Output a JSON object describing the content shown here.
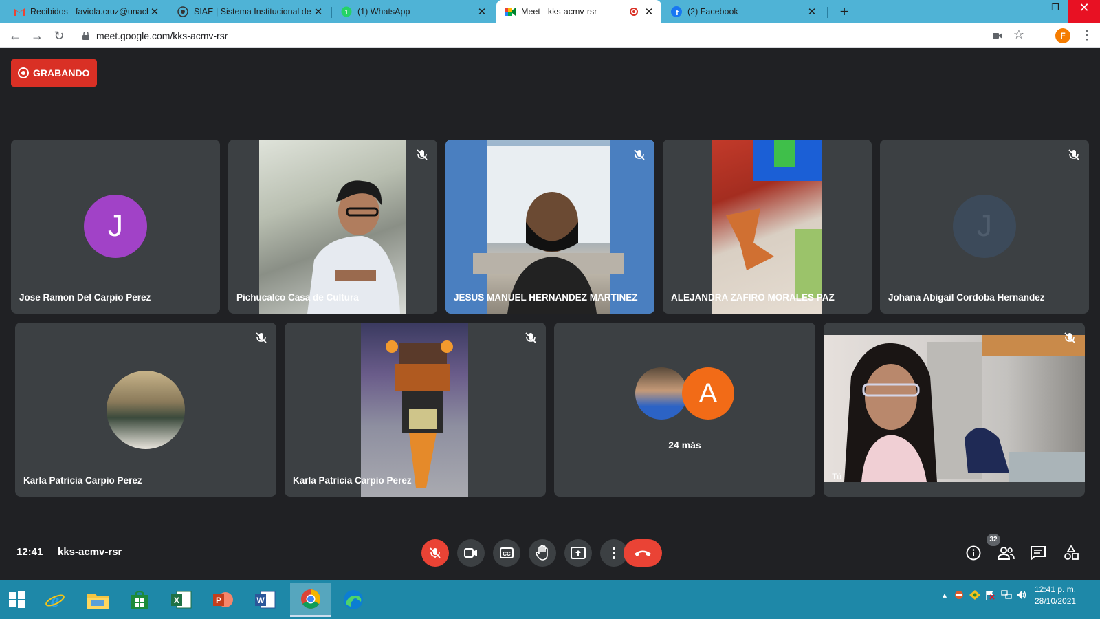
{
  "browser": {
    "tabs": [
      {
        "title": "Recibidos - faviola.cruz@unach.m",
        "icon": "gmail-icon"
      },
      {
        "title": "SIAE | Sistema Institucional de Ac",
        "icon": "siae-icon"
      },
      {
        "title": "(1) WhatsApp",
        "icon": "whatsapp-icon"
      },
      {
        "title": "Meet - kks-acmv-rsr",
        "icon": "meet-icon",
        "active": true
      },
      {
        "title": "(2) Facebook",
        "icon": "facebook-icon"
      }
    ],
    "url": "meet.google.com/kks-acmv-rsr",
    "profile_initial": "F"
  },
  "meet": {
    "recording_label": "GRABANDO",
    "participants": [
      {
        "name": "Jose Ramon Del Carpio Perez",
        "avatar_letter": "J",
        "avatar_color": "#a142c7"
      },
      {
        "name": "Pichucalco Casa de Cultura"
      },
      {
        "name": "JESUS MANUEL HERNANDEZ MARTINEZ"
      },
      {
        "name": "ALEJANDRA ZAFIRO MORALES PAZ"
      },
      {
        "name": "Johana Abigail Cordoba Hernandez",
        "avatar_letter": "J",
        "avatar_color": "#3c4a5a"
      },
      {
        "name": "Karla Patricia Carpio Perez"
      },
      {
        "name": "Karla Patricia Carpio Perez"
      },
      {
        "more_label": "24 más",
        "avatar_letter": "A",
        "avatar_color": "#f26b17"
      },
      {
        "name": "Tú"
      }
    ],
    "time": "12:41",
    "meeting_code": "kks-acmv-rsr",
    "participant_count": "32"
  },
  "taskbar": {
    "time": "12:41 p. m.",
    "date": "28/10/2021"
  },
  "colors": {
    "accent_red": "#ea4335",
    "tile_bg": "#3c4043",
    "page_bg": "#202124",
    "tabstrip": "#4fb3d6",
    "taskbar": "#1e88a8"
  }
}
